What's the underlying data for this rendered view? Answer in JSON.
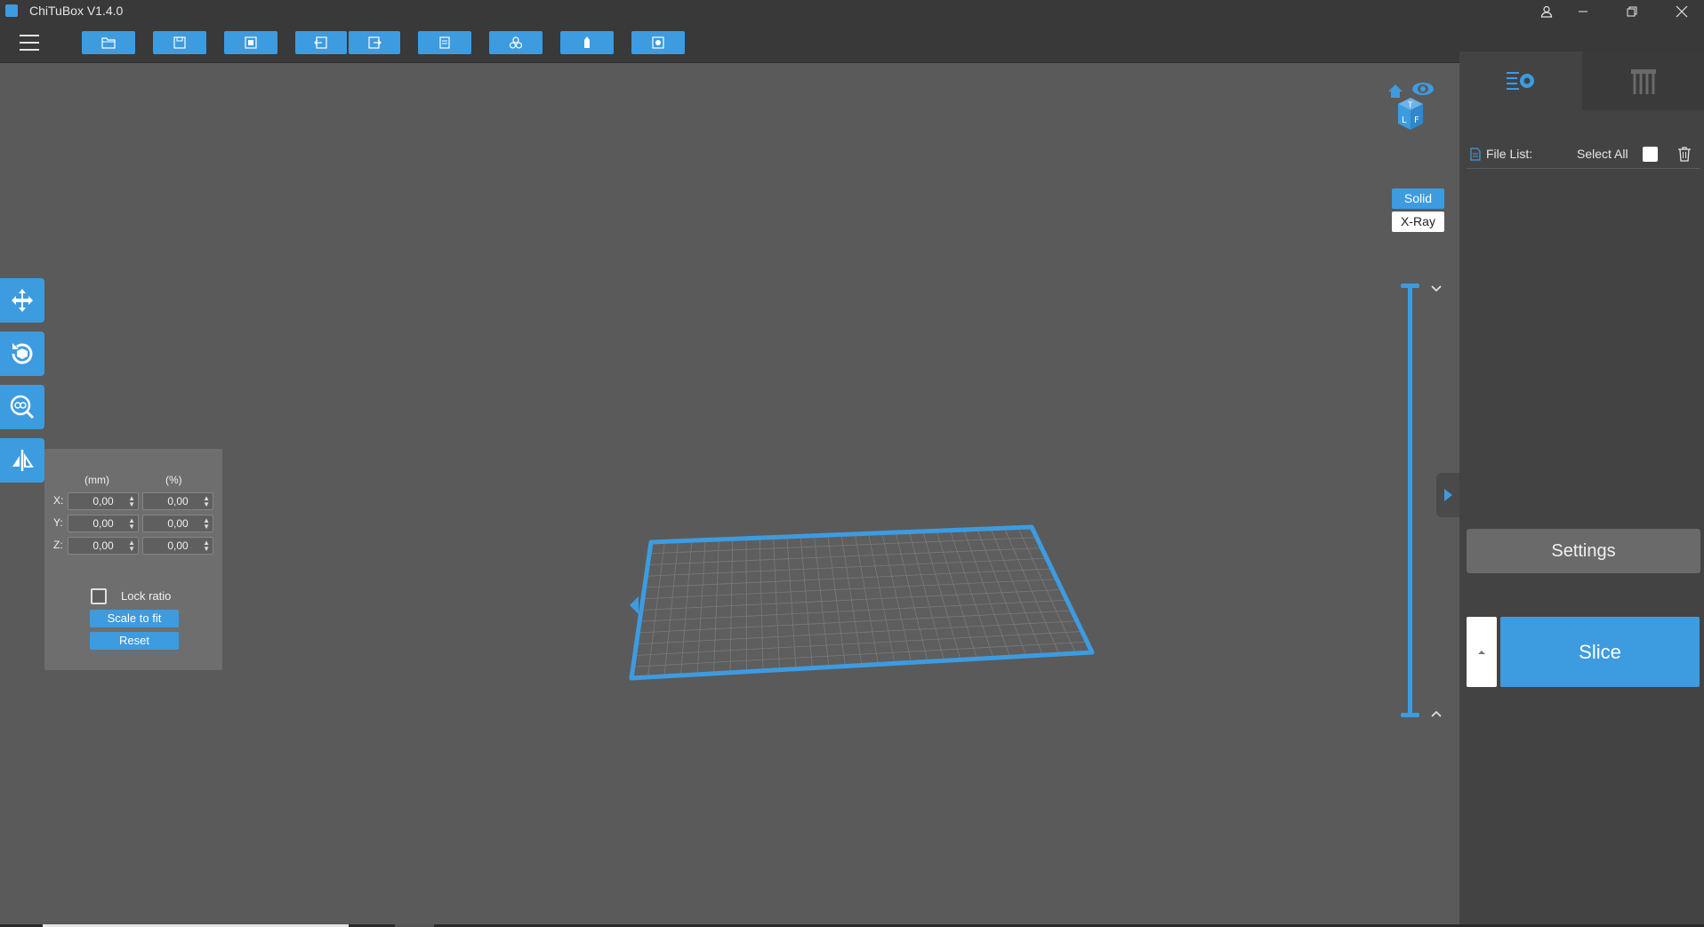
{
  "window": {
    "title": "ChiTuBox V1.4.0",
    "controls": [
      "user-icon",
      "minimize-icon",
      "restore-icon",
      "close-icon"
    ]
  },
  "toolbar": {
    "menu_icon": "hamburger-menu-icon",
    "buttons": [
      "open-file-icon",
      "save-icon",
      "fit-view-icon",
      "undo-icon",
      "redo-icon",
      "layers-icon",
      "group-icon",
      "support-icon",
      "screenshot-icon"
    ]
  },
  "left_tools": [
    "move-icon",
    "rotate-icon",
    "scale-icon",
    "mirror-icon"
  ],
  "scale_panel": {
    "col_mm": "(mm)",
    "col_pct": "(%)",
    "rows": [
      {
        "axis": "X:",
        "mm": "0,00",
        "pct": "0,00"
      },
      {
        "axis": "Y:",
        "mm": "0,00",
        "pct": "0,00"
      },
      {
        "axis": "Z:",
        "mm": "0,00",
        "pct": "0,00"
      }
    ],
    "lock_ratio": "Lock ratio",
    "lock_checked": false,
    "scale_to_fit": "Scale to fit",
    "reset": "Reset"
  },
  "view_modes": {
    "solid": "Solid",
    "xray": "X-Ray",
    "selected": "Solid"
  },
  "view_cube": {
    "icon": "view-cube-icon",
    "faces": [
      "T",
      "L",
      "F"
    ]
  },
  "right_panel": {
    "tabs": [
      "print-settings-icon",
      "supports-icon"
    ],
    "file_list_label": "File List:",
    "select_all_label": "Select All",
    "delete_icon": "trash-icon",
    "settings_label": "Settings",
    "slice_label": "Slice"
  },
  "colors": {
    "accent": "#3d9be0",
    "background": "#5a5a5a",
    "panel": "#434343",
    "titlebar": "#393939"
  }
}
